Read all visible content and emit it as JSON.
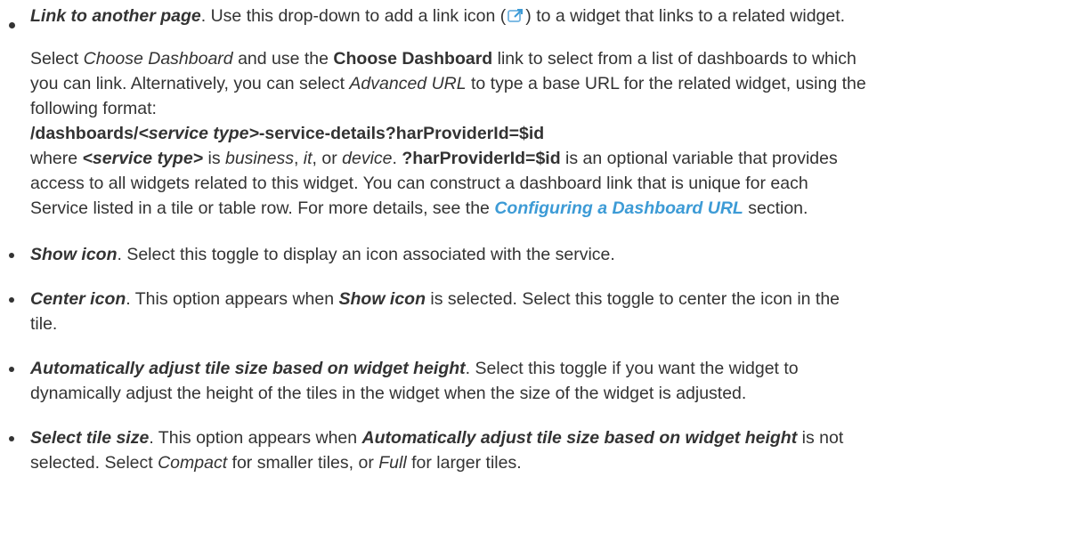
{
  "items": {
    "link": {
      "term": "Link to another page",
      "desc_a": ". Use this drop-down to add a link icon (",
      "desc_b": ") to a widget that links to a related widget.",
      "icon": "external-link-icon"
    },
    "link_detail": {
      "p1_a": "Select ",
      "p1_choose_italic": "Choose Dashboard",
      "p1_b": " and use the ",
      "p1_choose_bold": "Choose Dashboard",
      "p1_c": " link to select from a list of dashboards to which",
      "p2_a": "you can link. Alternatively, you can select ",
      "p2_adv": "Advanced URL",
      "p2_b": " to type a base URL for the related widget, using the",
      "p3": "following format:",
      "url_a": "/dashboards/",
      "url_var": "<service type>",
      "url_b": "-service-details?harProviderId=$id",
      "w_a": "where ",
      "w_var": "<service type>",
      "w_b": " is ",
      "w_business": "business",
      "w_c": ", ",
      "w_it": "it",
      "w_d": ", or ",
      "w_device": "device",
      "w_e": ". ",
      "w_param": "?harProviderId=$id",
      "w_f": " is an optional variable that provides",
      "a1": "access to all widgets related to this widget. You can construct a dashboard link that is unique for each",
      "s_a": "Service listed in a tile or table row. For more details, see the ",
      "s_link": "Configuring a Dashboard URL",
      "s_b": " section."
    },
    "show_icon": {
      "term": "Show icon",
      "desc": ". Select this toggle to display an icon associated with the service."
    },
    "center_icon": {
      "term": "Center icon",
      "desc_a": ". This option appears when ",
      "ref": "Show icon",
      "desc_b": " is selected. Select this toggle to center the icon in the",
      "desc_c": "tile."
    },
    "auto_adjust": {
      "term": "Automatically adjust tile size based on widget height",
      "desc_a": ". Select this toggle if you want the widget to",
      "desc_b": "dynamically adjust the height of the tiles in the widget when the size of the widget is adjusted."
    },
    "tile_size": {
      "term": "Select tile size",
      "desc_a": ". This option appears when ",
      "ref": "Automatically adjust tile size based on widget height",
      "desc_b": " is not",
      "desc_c": "selected. Select ",
      "compact": "Compact",
      "desc_d": " for smaller tiles, or ",
      "full": "Full",
      "desc_e": " for larger tiles."
    }
  }
}
